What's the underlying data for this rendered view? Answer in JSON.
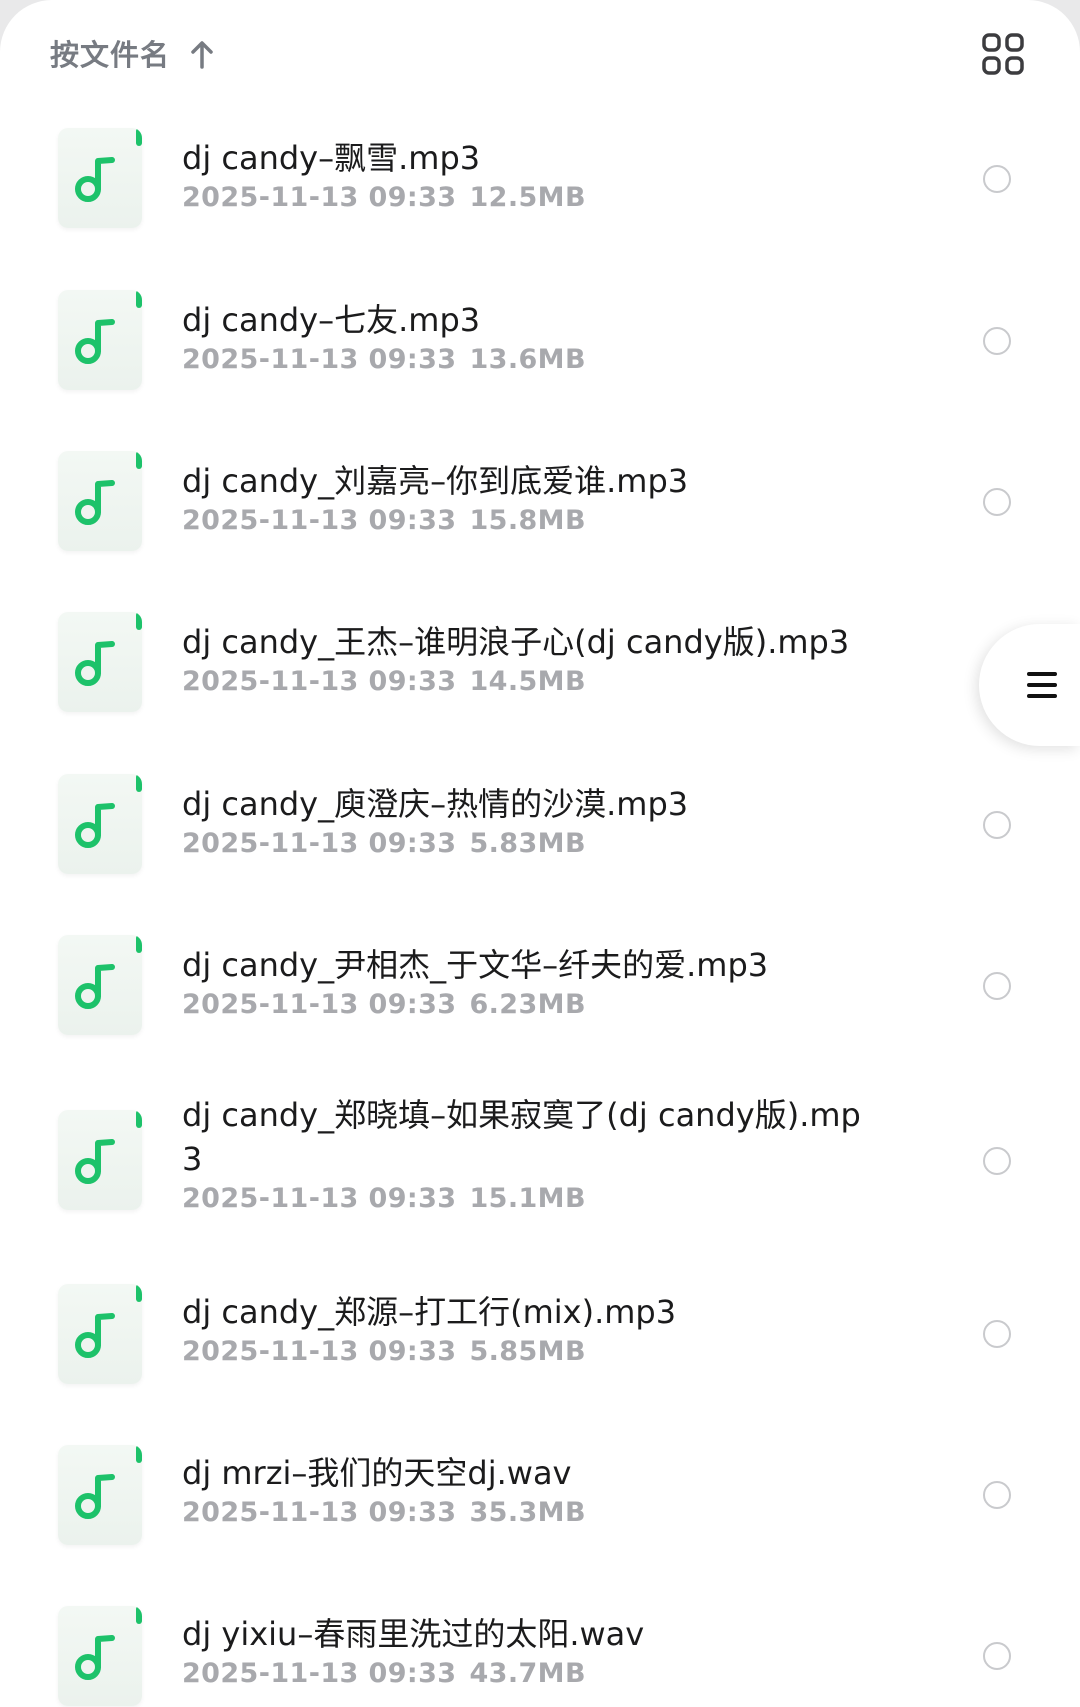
{
  "toolbar": {
    "sort_label": "按文件名",
    "sort_direction_icon": "arrow-up-icon",
    "view_toggle_icon": "grid-view-icon"
  },
  "floating_menu": {
    "icon": "menu-lines-icon"
  },
  "files": [
    {
      "name": "dj candy–飘雪.mp3",
      "date": "2025-11-13 09:33",
      "size": "12.5MB",
      "icon": "music-note-icon"
    },
    {
      "name": "dj candy–七友.mp3",
      "date": "2025-11-13 09:33",
      "size": "13.6MB",
      "icon": "music-note-icon"
    },
    {
      "name": "dj candy_刘嘉亮–你到底爱谁.mp3",
      "date": "2025-11-13 09:33",
      "size": "15.8MB",
      "icon": "music-note-icon"
    },
    {
      "name": "dj candy_王杰–谁明浪子心(dj candy版).mp3",
      "date": "2025-11-13 09:33",
      "size": "14.5MB",
      "icon": "music-note-icon"
    },
    {
      "name": "dj candy_庾澄庆–热情的沙漠.mp3",
      "date": "2025-11-13 09:33",
      "size": "5.83MB",
      "icon": "music-note-icon"
    },
    {
      "name": "dj candy_尹相杰_于文华–纤夫的爱.mp3",
      "date": "2025-11-13 09:33",
      "size": "6.23MB",
      "icon": "music-note-icon"
    },
    {
      "name": "dj candy_郑晓填–如果寂寞了(dj candy版).mp3",
      "date": "2025-11-13 09:33",
      "size": "15.1MB",
      "icon": "music-note-icon"
    },
    {
      "name": "dj candy_郑源–打工行(mix).mp3",
      "date": "2025-11-13 09:33",
      "size": "5.85MB",
      "icon": "music-note-icon"
    },
    {
      "name": "dj mrzi–我们的天空dj.wav",
      "date": "2025-11-13 09:33",
      "size": "35.3MB",
      "icon": "music-note-icon"
    },
    {
      "name": "dj yixiu–春雨里洗过的太阳.wav",
      "date": "2025-11-13 09:33",
      "size": "43.7MB",
      "icon": "music-note-icon"
    }
  ]
}
